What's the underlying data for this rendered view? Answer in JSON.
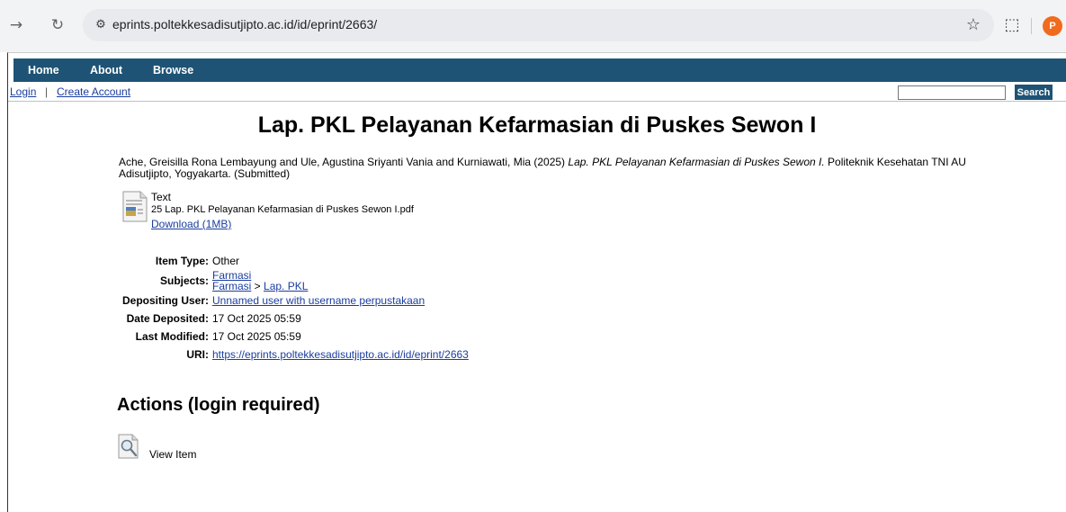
{
  "browser": {
    "url": "eprints.poltekkesadisutjipto.ac.id/id/eprint/2663/",
    "profile_initial": "P"
  },
  "menu": {
    "home": "Home",
    "about": "About",
    "browse": "Browse"
  },
  "subbar": {
    "login": "Login",
    "separator": "|",
    "create_account": "Create Account",
    "search_value": "",
    "search_button": "Search"
  },
  "eprint": {
    "title": "Lap. PKL Pelayanan Kefarmasian di Puskes Sewon I",
    "citation_authors": "Ache, Greisilla Rona Lembayung and Ule, Agustina Sriyanti Vania and Kurniawati, Mia (2025) ",
    "citation_title": "Lap. PKL Pelayanan Kefarmasian di Puskes Sewon I.",
    "citation_publisher": " Politeknik Kesehatan TNI AU Adisutjipto, Yogyakarta. (Submitted)",
    "document": {
      "type": "Text",
      "filename": "25 Lap. PKL Pelayanan Kefarmasian di Puskes Sewon I.pdf",
      "download": "Download (1MB)"
    },
    "details": {
      "item_type_label": "Item Type:",
      "item_type": "Other",
      "subjects_label": "Subjects:",
      "subject_1": "Farmasi",
      "subject_2_parent": "Farmasi",
      "subject_2_sep": " > ",
      "subject_2_child": "Lap. PKL",
      "depositing_user_label": "Depositing User:",
      "depositing_user": "Unnamed user with username perpustakaan",
      "date_deposited_label": "Date Deposited:",
      "date_deposited": "17 Oct 2025 05:59",
      "last_modified_label": "Last Modified:",
      "last_modified": "17 Oct 2025 05:59",
      "uri_label": "URI:",
      "uri": "https://eprints.poltekkesadisutjipto.ac.id/id/eprint/2663"
    },
    "actions_heading": "Actions (login required)",
    "view_item": "View Item"
  },
  "colors": {
    "menubar": "#1e5375",
    "link": "#1a3e9e",
    "profile": "#f06b1d"
  },
  "icons": [
    "forward-icon",
    "reload-icon",
    "site-info-icon",
    "star-icon",
    "extensions-icon",
    "pdf-document-icon",
    "magnifier-icon"
  ]
}
